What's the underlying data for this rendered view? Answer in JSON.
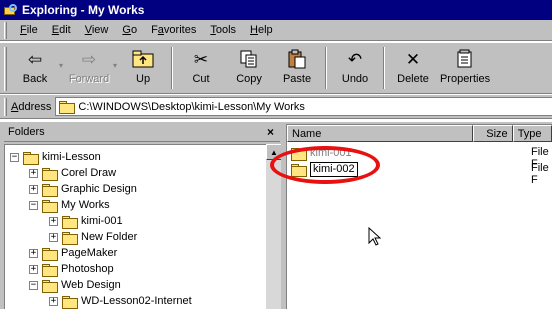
{
  "window": {
    "title": "Exploring - My Works"
  },
  "menu": [
    {
      "key": "F",
      "rest": "ile"
    },
    {
      "key": "E",
      "rest": "dit"
    },
    {
      "key": "V",
      "rest": "iew"
    },
    {
      "key": "G",
      "rest": "o"
    },
    {
      "key": "a",
      "pre": "F",
      "rest": "vorites"
    },
    {
      "key": "T",
      "rest": "ools"
    },
    {
      "key": "H",
      "rest": "elp"
    }
  ],
  "toolbar": {
    "back": "Back",
    "forward": "Forward",
    "up": "Up",
    "cut": "Cut",
    "copy": "Copy",
    "paste": "Paste",
    "undo": "Undo",
    "delete": "Delete",
    "properties": "Properties"
  },
  "address": {
    "label_key": "A",
    "label_rest": "ddress",
    "path": "C:\\WINDOWS\\Desktop\\kimi-Lesson\\My Works"
  },
  "left_pane": {
    "header": "Folders",
    "close_glyph": "×",
    "tree": [
      {
        "label": "kimi-Lesson",
        "expander": "−"
      },
      {
        "label": "Corel Draw",
        "expander": "+"
      },
      {
        "label": "Graphic Design",
        "expander": "+"
      },
      {
        "label": "My Works",
        "expander": "−"
      },
      {
        "label": "kimi-001",
        "expander": "+"
      },
      {
        "label": "New Folder",
        "expander": "+"
      },
      {
        "label": "PageMaker",
        "expander": "+"
      },
      {
        "label": "Photoshop",
        "expander": "+"
      },
      {
        "label": "Web Design",
        "expander": "−"
      },
      {
        "label": "WD-Lesson02-Internet",
        "expander": "+"
      }
    ]
  },
  "right_pane": {
    "columns": {
      "name": "Name",
      "size": "Size",
      "type": "Type"
    },
    "files": [
      {
        "name": "kimi-001",
        "type": "File F"
      },
      {
        "name": "kimi-002",
        "type": "File F"
      }
    ]
  },
  "colors": {
    "titlebar": "#000080",
    "annotation": "#e81010",
    "folder": "#ffe680"
  }
}
